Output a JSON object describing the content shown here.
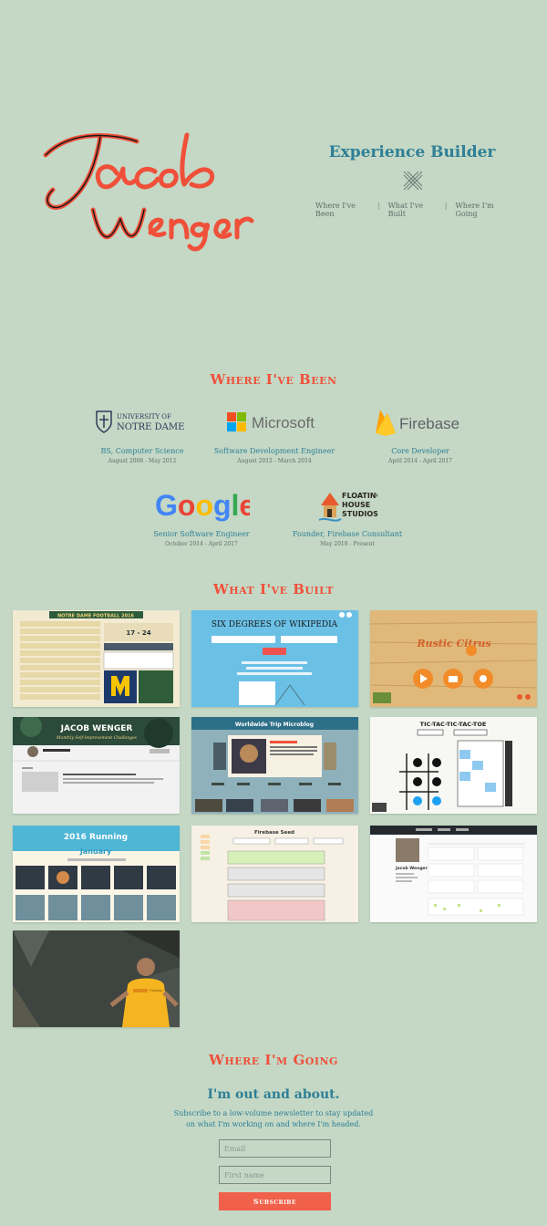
{
  "header": {
    "logo_text": [
      "Jacob",
      "Wenger"
    ],
    "tagline": "Experience Builder",
    "nav": [
      {
        "label": "Where I've Been"
      },
      {
        "label": "What I've Built"
      },
      {
        "label": "Where I'm Going"
      }
    ]
  },
  "where_been": {
    "title": "Where I've Been",
    "jobs": [
      {
        "company": "UNIVERSITY OF NOTRE DAME",
        "role": "BS, Computer Science",
        "dates": "August 2008 - May 2012"
      },
      {
        "company": "Microsoft",
        "role": "Software Development Engineer",
        "dates": "August 2012 - March 2014"
      },
      {
        "company": "Firebase",
        "role": "Core Developer",
        "dates": "April 2014 - April 2017"
      },
      {
        "company": "Google",
        "role": "Senior Software Engineer",
        "dates": "October 2014 - April 2017"
      },
      {
        "company": "FLOATING HOUSE STUDIOS",
        "role": "Founder, Firebase Consultant",
        "dates": "May 2018 - Present"
      }
    ]
  },
  "what_built": {
    "title": "What I've Built",
    "projects": [
      {
        "name": "NOTRE DAME FOOTBALL 2016",
        "score": "17 - 24"
      },
      {
        "name": "SIX DEGREES OF WIKIPEDIA"
      },
      {
        "name": "Rustic Citrus"
      },
      {
        "name": "JACOB WENGER",
        "subtitle": "Monthly Self-Improvement Challenges"
      },
      {
        "name": "Worldwide Trip Microblog"
      },
      {
        "name": "TIC-TAC-TIC-TAC-TOE"
      },
      {
        "name": "2016 Running",
        "subtitle": "January"
      },
      {
        "name": "Firebase Seed"
      },
      {
        "name": "Jacob Wenger"
      },
      {
        "name": "Firebase"
      }
    ]
  },
  "where_going": {
    "title": "Where I'm Going",
    "heading": "I'm out and about.",
    "subtext": "Subscribe to a low-volume newsletter to stay updated on what I'm working on and where I'm headed.",
    "email_placeholder": "Email",
    "name_placeholder": "First name",
    "button_label": "Subscribe"
  },
  "colors": {
    "background": "#c4d8c5",
    "accent_red": "#f0503a",
    "accent_blue": "#2f7f96"
  }
}
